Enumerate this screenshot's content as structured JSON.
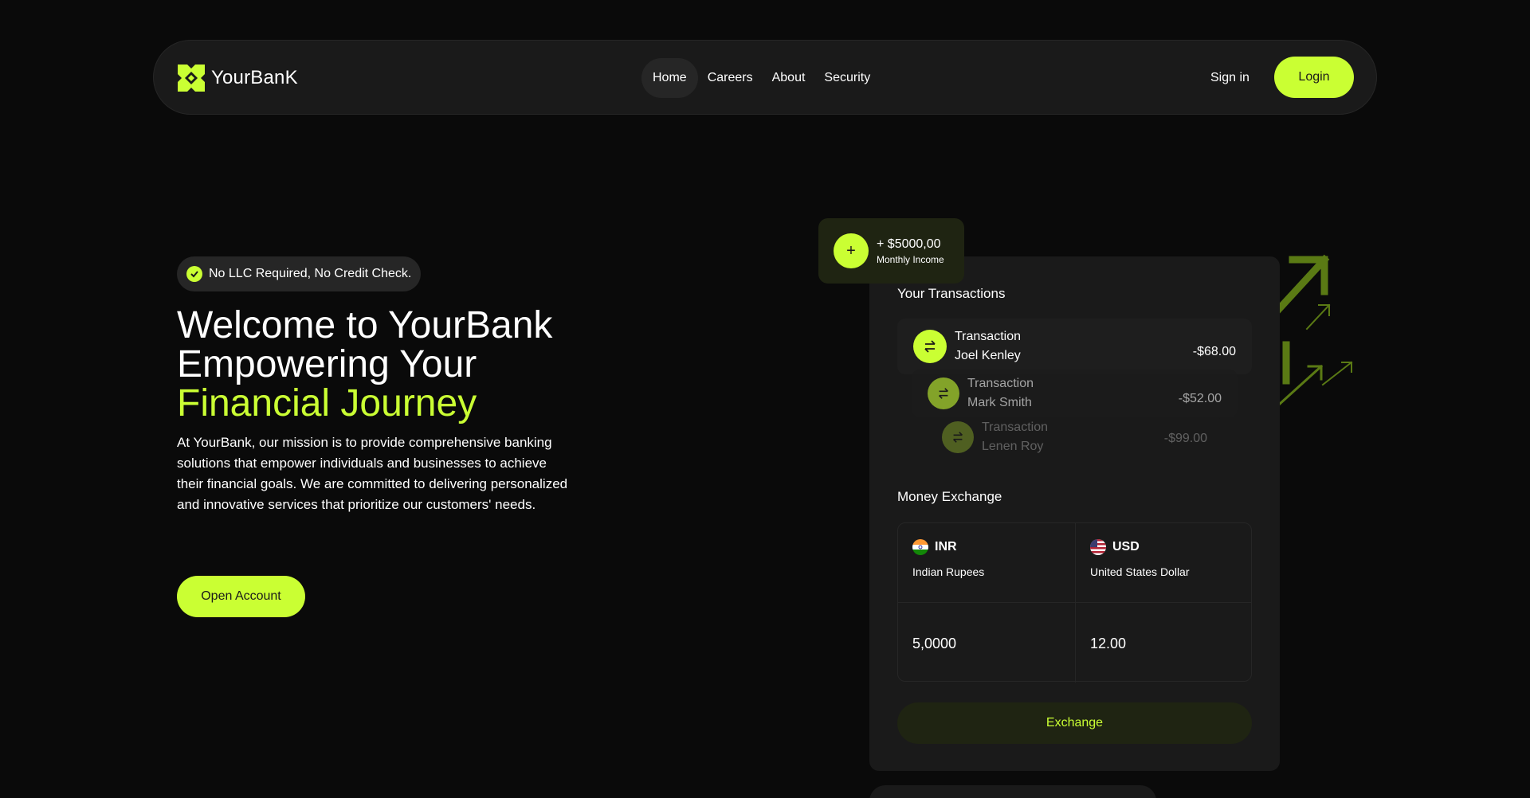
{
  "nav": {
    "brand": "YourBanK",
    "links": [
      "Home",
      "Careers",
      "About",
      "Security"
    ],
    "signin_label": "Sign in",
    "login_label": "Login"
  },
  "hero": {
    "badge": "No LLC Required, No Credit Check.",
    "headline_line1": "Welcome to YourBank",
    "headline_line2": "Empowering Your",
    "headline_accent": "Financial Journey",
    "description": "At YourBank, our mission is to provide comprehensive banking solutions that empower individuals and businesses to achieve their financial goals. We are committed to delivering personalized and innovative services that prioritize our customers' needs.",
    "cta_label": "Open Account"
  },
  "income": {
    "amount": "+ $5000,00",
    "label": "Monthly Income"
  },
  "transactions": {
    "title": "Your Transactions",
    "items": [
      {
        "type": "Transaction",
        "name": "Joel Kenley",
        "amount": "-$68.00"
      },
      {
        "type": "Transaction",
        "name": "Mark Smith",
        "amount": "-$52.00"
      },
      {
        "type": "Transaction",
        "name": "Lenen Roy",
        "amount": "-$99.00"
      }
    ]
  },
  "exchange": {
    "title": "Money Exchange",
    "from": {
      "code": "INR",
      "name": "Indian Rupees",
      "value": "5,0000"
    },
    "to": {
      "code": "USD",
      "name": "United States Dollar",
      "value": "12.00"
    },
    "button_label": "Exchange"
  },
  "colors": {
    "accent": "#caff33",
    "background": "#0a0a0a",
    "card": "#1a1a1a"
  }
}
